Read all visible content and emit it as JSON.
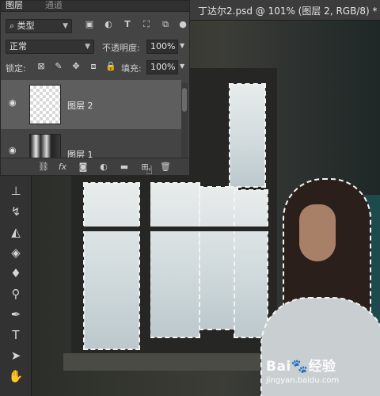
{
  "document": {
    "tab_title": "丁达尔2.psd @ 101% (图层 2, RGB/8) *"
  },
  "layers_panel": {
    "tabs": [
      "图层",
      "通道"
    ],
    "filter_kind": "类型",
    "blend_mode": "正常",
    "opacity_label": "不透明度:",
    "opacity_value": "100%",
    "lock_label": "锁定:",
    "fill_label": "填充:",
    "fill_value": "100%",
    "layers": [
      {
        "name": "图层 2",
        "visible": true,
        "selected": true,
        "thumbnail": "transparent-checker"
      },
      {
        "name": "图层 1",
        "visible": true,
        "selected": false,
        "thumbnail": "window-photo"
      }
    ],
    "filter_icons": [
      "image-filter-icon",
      "adjustment-filter-icon",
      "type-filter-icon",
      "shape-filter-icon",
      "smart-object-filter-icon"
    ],
    "lock_icons": [
      "lock-transparent-icon",
      "lock-image-icon",
      "lock-position-icon",
      "lock-artboard-icon",
      "lock-all-icon"
    ],
    "footer_icons": [
      "link-icon",
      "fx-icon",
      "mask-icon",
      "adjustment-layer-icon",
      "folder-icon",
      "new-layer-icon",
      "trash-icon"
    ]
  },
  "tools": [
    "clone-stamp-icon",
    "history-brush-icon",
    "eraser-icon",
    "paint-bucket-icon",
    "blur-icon",
    "dodge-icon",
    "pen-icon",
    "type-icon",
    "path-select-icon",
    "hand-icon"
  ],
  "watermark": {
    "brand": "Bai",
    "brand_suffix": "经验",
    "url": "jingyan.baidu.com"
  },
  "colors": {
    "panel_bg": "#444444",
    "selected_layer": "#5e5e5e",
    "canvas_frame": "#2b2b2b"
  }
}
